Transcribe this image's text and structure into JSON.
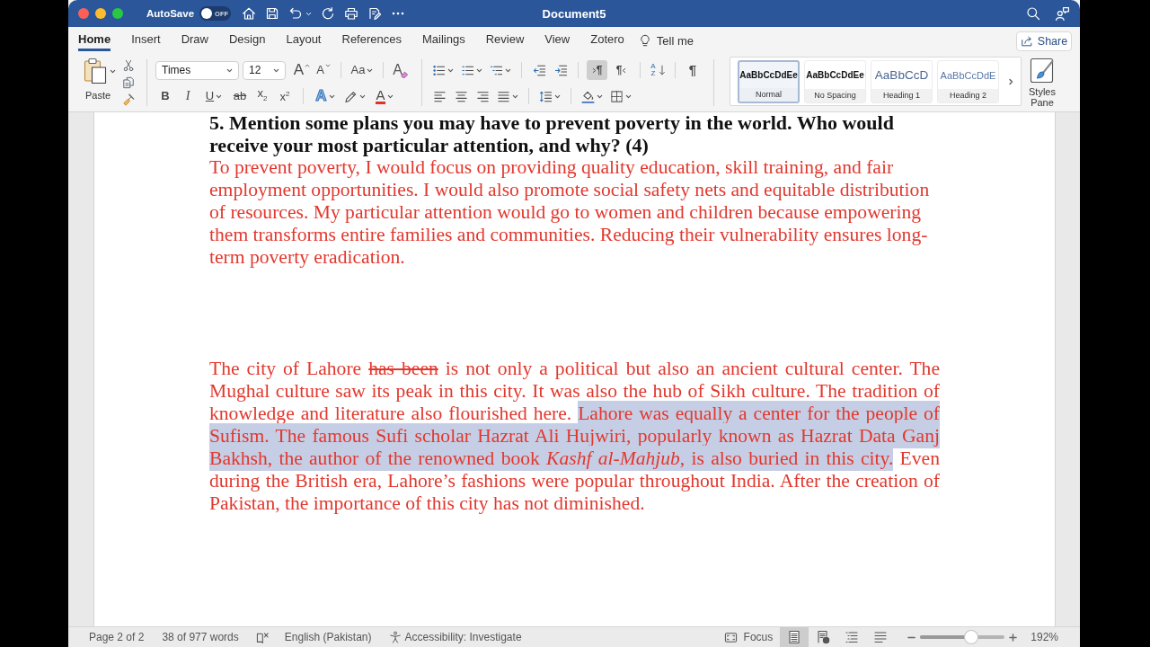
{
  "window": {
    "title": "Document5"
  },
  "autosave": {
    "label": "AutoSave",
    "on": false,
    "state": "OFF"
  },
  "tabs": [
    {
      "label": "Home",
      "selected": true
    },
    {
      "label": "Insert",
      "selected": false
    },
    {
      "label": "Draw",
      "selected": false
    },
    {
      "label": "Design",
      "selected": false
    },
    {
      "label": "Layout",
      "selected": false
    },
    {
      "label": "References",
      "selected": false
    },
    {
      "label": "Mailings",
      "selected": false
    },
    {
      "label": "Review",
      "selected": false
    },
    {
      "label": "View",
      "selected": false
    },
    {
      "label": "Zotero",
      "selected": false
    }
  ],
  "tell_me": "Tell me",
  "share": "Share",
  "clipboard": {
    "paste": "Paste"
  },
  "font": {
    "name": "Times",
    "size": "12",
    "grow": "A",
    "shrink": "A",
    "change_case": "Aa",
    "clear": "A",
    "bold": "B",
    "italic": "I",
    "underline": "U",
    "strikethrough": "ab",
    "subscript": "x$_{2}$",
    "superscript": "x$^{2}$",
    "effects": "A",
    "font_color": "A"
  },
  "paragraph": {
    "direction": [
      {
        "kind": "ltr",
        "label": "¶",
        "selected": true
      },
      {
        "kind": "rtl",
        "label": "¶",
        "selected": false
      }
    ],
    "sort": "A Z",
    "marks": "¶"
  },
  "styles": {
    "items": [
      {
        "kind": "body",
        "preview": "AaBbCcDdEe",
        "name": "Normal",
        "selected": true
      },
      {
        "kind": "body",
        "preview": "AaBbCcDdEe",
        "name": "No Spacing",
        "selected": false
      },
      {
        "kind": "heading1",
        "preview": "AaBbCcD",
        "name": "Heading 1",
        "selected": false
      },
      {
        "kind": "heading2",
        "preview": "AaBbCcDdE",
        "name": "Heading 2",
        "selected": false
      }
    ],
    "pane": "Styles Pane"
  },
  "document": {
    "blocks": [
      {
        "kind": "question",
        "text": "5. Mention some plans you may have to prevent poverty in the world. Who would receive your most particular attention, and why? (4)"
      },
      {
        "kind": "answer",
        "text": "To prevent poverty, I would focus on providing quality education, skill training, and fair employment opportunities. I would also promote social safety nets and equitable distribution of resources. My particular attention would go to women and children because empowering them transforms entire families and communities. Reducing their vulnerability ensures long-term poverty eradication."
      },
      {
        "kind": "passage",
        "runs": [
          {
            "text": "The city of Lahore ",
            "struck": false,
            "selected": false
          },
          {
            "text": "has been",
            "struck": true,
            "selected": false
          },
          {
            "text": " is not only a political but also an ancient cultural center. The Mughal culture saw its peak in this city. It was also the hub of Sikh culture. The tradition of knowledge and literature also flourished here. ",
            "struck": false,
            "selected": false
          },
          {
            "text": "Lahore was equally a center for the people of Sufism. The famous Sufi scholar Hazrat Ali Hujwiri, popularly known as Hazrat Data Ganj Bakhsh, the author of the renowned book *Kashf al-Mahjub*, is also buried in this city.",
            "struck": false,
            "selected": true
          },
          {
            "text": " Even during the British era, Lahore’s fashions were popular throughout India. After the creation of Pakistan, the importance of this city has not diminished.",
            "struck": false,
            "selected": false
          }
        ]
      }
    ]
  },
  "status_bar": {
    "page": "Page 2 of 2",
    "words": "38 of 977 words",
    "language": "English (Pakistan)",
    "accessibility": "Accessibility: Investigate",
    "focus": "Focus",
    "views": [
      {
        "kind": "print",
        "selected": true
      },
      {
        "kind": "web",
        "selected": false
      },
      {
        "kind": "outline",
        "selected": false
      },
      {
        "kind": "draft",
        "selected": false
      }
    ],
    "zoom": {
      "level": 0.6,
      "reading": "192%"
    }
  }
}
